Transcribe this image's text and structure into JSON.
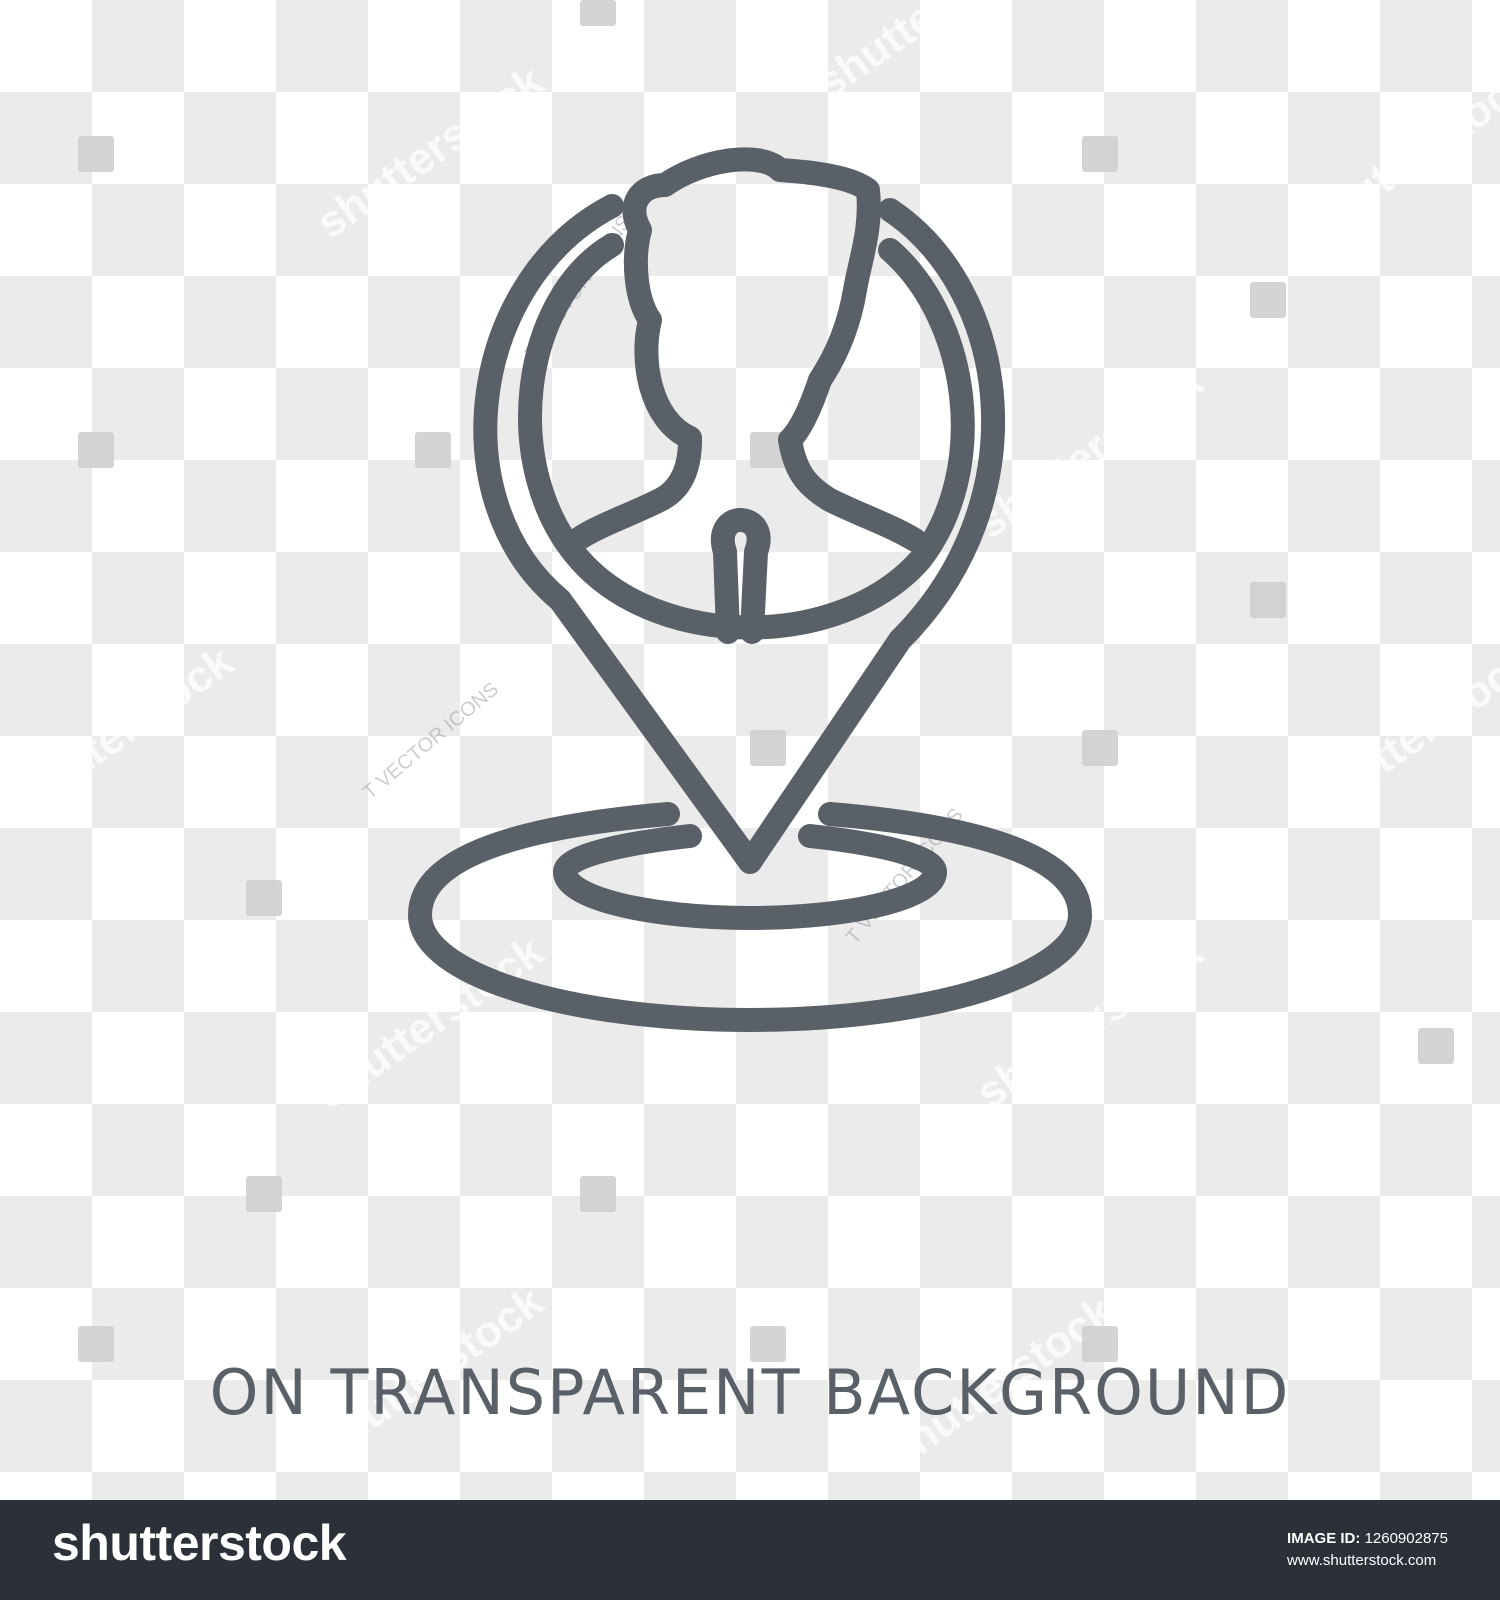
{
  "caption": "ON TRANSPARENT BACKGROUND",
  "footer": {
    "brand": "shutterstock",
    "image_id_label": "IMAGE ID:",
    "image_id": "1260902875",
    "site": "www.shutterstock.com"
  },
  "watermark": {
    "text": "shutterstock",
    "author_text": "T VECTOR ICONS"
  },
  "icon": {
    "name": "businessman-location-pin",
    "stroke_color": "#5a6068"
  },
  "colors": {
    "checker_light": "#ffffff",
    "checker_dark": "#ebebeb",
    "footer_bg": "#2c3038",
    "caption": "#5a6068"
  }
}
